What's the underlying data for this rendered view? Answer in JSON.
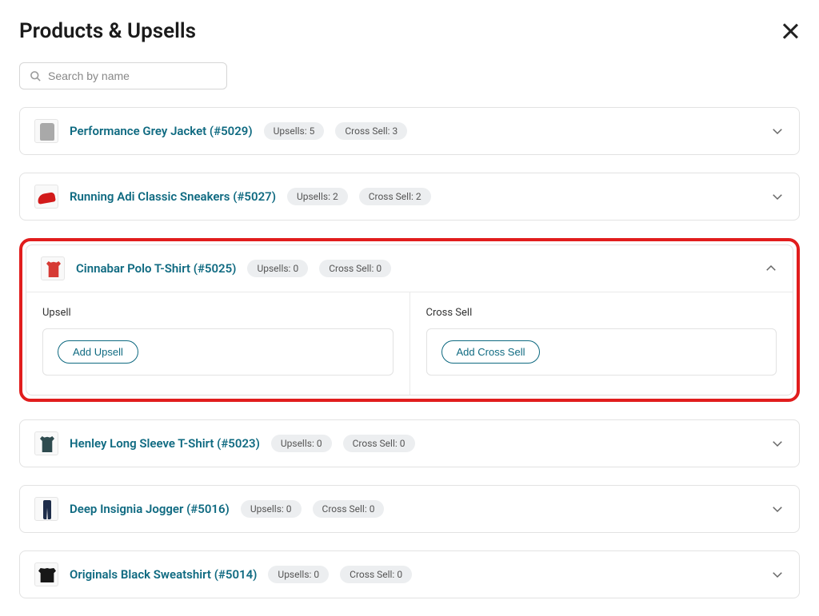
{
  "header": {
    "title": "Products & Upsells"
  },
  "search": {
    "placeholder": "Search by name"
  },
  "labels": {
    "upsell": "Upsell",
    "cross_sell": "Cross Sell",
    "add_upsell": "Add Upsell",
    "add_cross_sell": "Add Cross Sell"
  },
  "products": [
    {
      "name": "Performance Grey Jacket (#5029)",
      "upsells_badge": "Upsells: 5",
      "cross_badge": "Cross Sell: 3",
      "thumb": "jacket",
      "expanded": false,
      "highlighted": false
    },
    {
      "name": "Running Adi Classic Sneakers (#5027)",
      "upsells_badge": "Upsells: 2",
      "cross_badge": "Cross Sell: 2",
      "thumb": "sneakers",
      "expanded": false,
      "highlighted": false
    },
    {
      "name": "Cinnabar Polo T-Shirt (#5025)",
      "upsells_badge": "Upsells: 0",
      "cross_badge": "Cross Sell: 0",
      "thumb": "polo",
      "expanded": true,
      "highlighted": true
    },
    {
      "name": "Henley Long Sleeve T-Shirt (#5023)",
      "upsells_badge": "Upsells: 0",
      "cross_badge": "Cross Sell: 0",
      "thumb": "henley",
      "expanded": false,
      "highlighted": false
    },
    {
      "name": "Deep Insignia Jogger (#5016)",
      "upsells_badge": "Upsells: 0",
      "cross_badge": "Cross Sell: 0",
      "thumb": "jogger",
      "expanded": false,
      "highlighted": false
    },
    {
      "name": "Originals Black Sweatshirt (#5014)",
      "upsells_badge": "Upsells: 0",
      "cross_badge": "Cross Sell: 0",
      "thumb": "sweat",
      "expanded": false,
      "highlighted": false
    }
  ]
}
